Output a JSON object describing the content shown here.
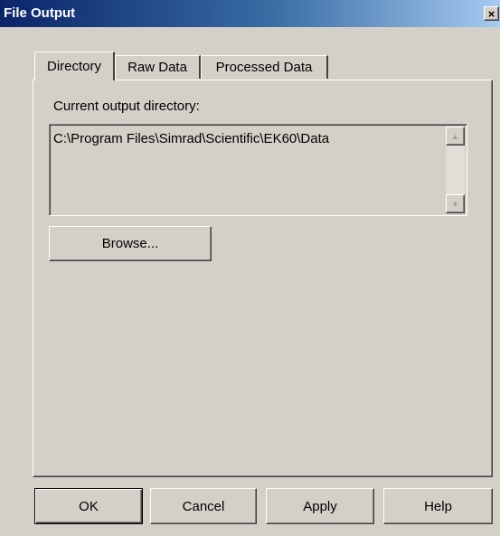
{
  "window": {
    "title": "File Output",
    "close_glyph": "×",
    "close_icon": "close-icon"
  },
  "tabs": [
    {
      "label": "Directory",
      "active": true
    },
    {
      "label": "Raw Data",
      "active": false
    },
    {
      "label": "Processed Data",
      "active": false
    }
  ],
  "directory": {
    "label": "Current output directory:",
    "path": "C:\\Program Files\\Simrad\\Scientific\\EK60\\Data",
    "scroll_up_glyph": "▲",
    "scroll_down_glyph": "▼",
    "browse_label": "Browse..."
  },
  "footer": {
    "ok_label": "OK",
    "cancel_label": "Cancel",
    "apply_label": "Apply",
    "help_label": "Help"
  },
  "colors": {
    "face": "#d4d0c8",
    "title_start": "#0a246a",
    "title_end": "#a6caf0"
  }
}
